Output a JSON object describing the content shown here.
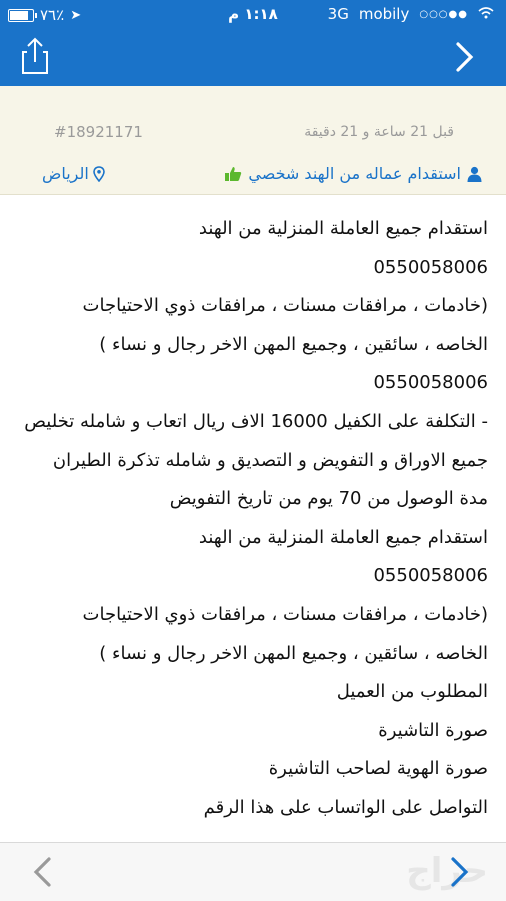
{
  "status_bar": {
    "battery": "٧٦٪",
    "battery_level": 0.76,
    "time": "١:١٨ م",
    "network": "3G",
    "carrier": "mobily"
  },
  "nav": {
    "share_icon": "share-icon",
    "back_icon": "chevron-right-icon"
  },
  "meta": {
    "ad_id": "#18921171",
    "posted": "قبل 21 ساعة و 21 دقيقة",
    "location": "الرياض",
    "category": "استقدام عماله من الهند شخصي"
  },
  "content": {
    "lines": [
      "استقدام جميع العاملة المنزلية من الهند",
      "0550058006",
      "(خادمات ، مرافقات مسنات ، مرافقات ذوي الاحتياجات",
      "الخاصه ، سائقين ، وجميع المهن الاخر رجال و نساء )",
      "0550058006",
      "- التكلفة على الكفيل 16000 الاف ريال اتعاب و شامله تخليص",
      "جميع الاوراق و التفويض و التصديق و شامله تذكرة الطيران",
      "مدة الوصول من 70 يوم من تاريخ التفويض",
      "استقدام جميع العاملة المنزلية من الهند",
      "0550058006",
      "(خادمات ، مرافقات مسنات ، مرافقات ذوي الاحتياجات",
      "الخاصه ، سائقين ، وجميع المهن الاخر رجال و نساء )",
      "المطلوب من العميل",
      "صورة التاشيرة",
      "صورة الهوية لصاحب التاشيرة",
      "التواصل على الواتساب على هذا الرقم"
    ]
  },
  "toolbar": {
    "watermark": "حراج"
  },
  "colors": {
    "brand": "#1a73c9",
    "meta_bg": "#f7f5e8",
    "thumb": "#5cb82e"
  }
}
